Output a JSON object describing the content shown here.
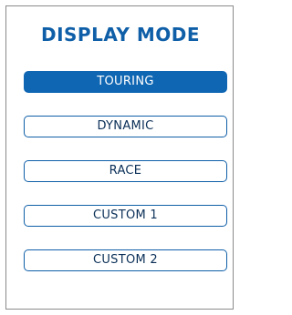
{
  "title": "DISPLAY MODE",
  "modes": [
    {
      "label": "TOURING",
      "selected": true
    },
    {
      "label": "DYNAMIC",
      "selected": false
    },
    {
      "label": "RACE",
      "selected": false
    },
    {
      "label": "CUSTOM 1",
      "selected": false
    },
    {
      "label": "CUSTOM 2",
      "selected": false
    }
  ],
  "colors": {
    "accent": "#0f66b3",
    "title": "#0f5fa8",
    "button_text": "#0a2f57",
    "panel_border": "#8a8a8a"
  }
}
